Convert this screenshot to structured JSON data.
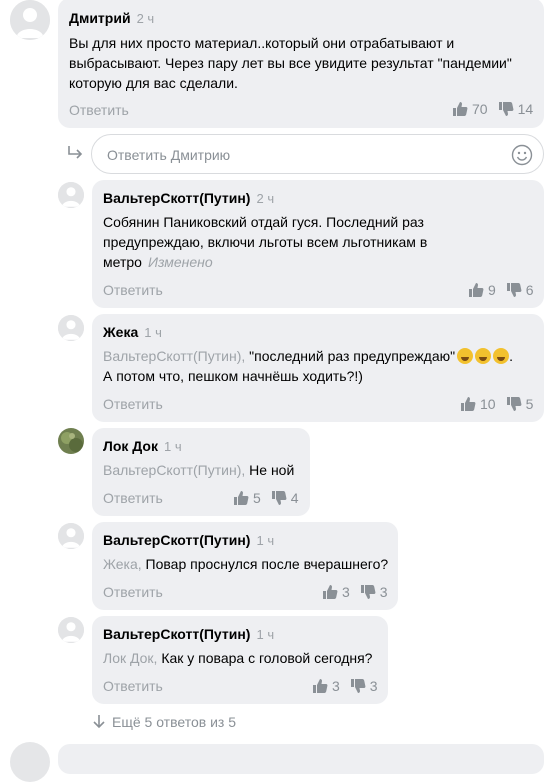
{
  "colors": {
    "bubble": "#eeeff2",
    "muted": "#9ea3a8",
    "accent_text": "#000000"
  },
  "comments": [
    {
      "author": "Дмитрий",
      "time": "2 ч",
      "text": "Вы для них просто материал..который они отрабатывают и выбрасывают. Через пару лет вы все увидите результат \"пандемии\" которую для вас сделали.",
      "reply_label": "Ответить",
      "likes": "70",
      "dislikes": "14"
    },
    {
      "author": "ВальтерСкотт(Путин)",
      "time": "2 ч",
      "text": "Собянин Паниковский отдай гуся. Последний раз предупреждаю, включи льготы всем льготникам в метро",
      "edited": "Изменено",
      "reply_label": "Ответить",
      "likes": "9",
      "dislikes": "6"
    },
    {
      "author": "Жека",
      "time": "1 ч",
      "mention": "ВальтерСкотт(Путин),",
      "text": "\"последний раз предупреждаю\"",
      "text2": "А потом что, пешком начнёшь ходить?!)",
      "reply_label": "Ответить",
      "likes": "10",
      "dislikes": "5"
    },
    {
      "author": "Лок Док",
      "time": "1 ч",
      "mention": "ВальтерСкотт(Путин),",
      "text": "Не ной",
      "reply_label": "Ответить",
      "likes": "5",
      "dislikes": "4"
    },
    {
      "author": "ВальтерСкотт(Путин)",
      "time": "1 ч",
      "mention": "Жека,",
      "text": "Повар проснулся после вчерашнего?",
      "reply_label": "Ответить",
      "likes": "3",
      "dislikes": "3"
    },
    {
      "author": "ВальтерСкотт(Путин)",
      "time": "1 ч",
      "mention": "Лок Док,",
      "text": "Как у повара с головой сегодня?",
      "reply_label": "Ответить",
      "likes": "3",
      "dislikes": "3"
    }
  ],
  "reply_input": {
    "placeholder": "Ответить Дмитрию",
    "value": ""
  },
  "more_replies": "Ещё 5 ответов из 5",
  "icons": {
    "like": "thumb-up-icon",
    "dislike": "thumb-down-icon",
    "smile": "smile-icon",
    "reply_arrow": "reply-arrow-icon",
    "more": "arrow-down-icon"
  }
}
